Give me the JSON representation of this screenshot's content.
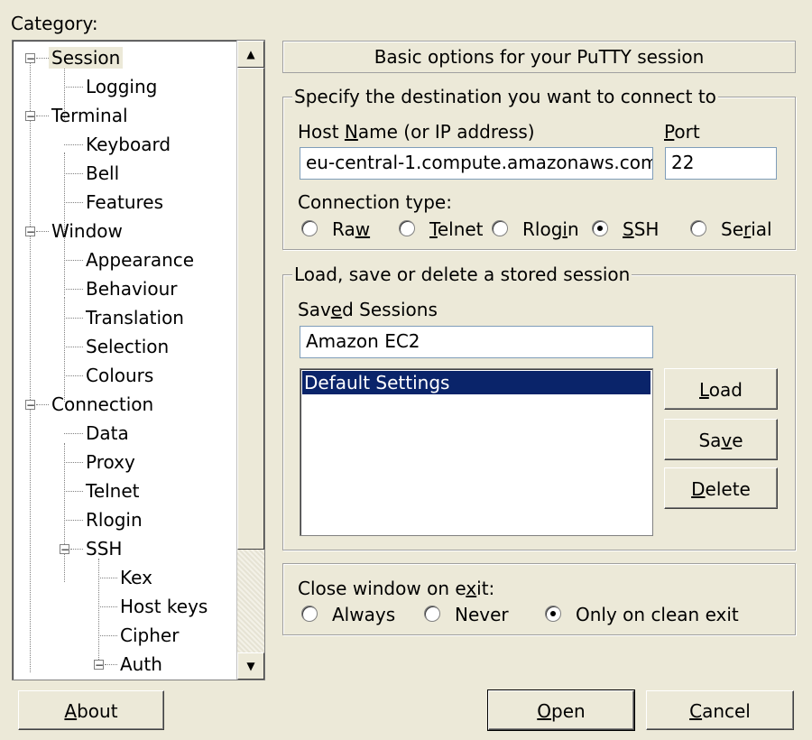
{
  "category_label": "Category:",
  "tree": [
    {
      "label": "Session",
      "expander": "−",
      "selected": true
    },
    {
      "label": "Logging"
    },
    {
      "label": "Terminal",
      "expander": "−"
    },
    {
      "label": "Keyboard"
    },
    {
      "label": "Bell"
    },
    {
      "label": "Features"
    },
    {
      "label": "Window",
      "expander": "−"
    },
    {
      "label": "Appearance"
    },
    {
      "label": "Behaviour"
    },
    {
      "label": "Translation"
    },
    {
      "label": "Selection"
    },
    {
      "label": "Colours"
    },
    {
      "label": "Connection",
      "expander": "−"
    },
    {
      "label": "Data"
    },
    {
      "label": "Proxy"
    },
    {
      "label": "Telnet"
    },
    {
      "label": "Rlogin"
    },
    {
      "label": "SSH",
      "expander": "−"
    },
    {
      "label": "Kex"
    },
    {
      "label": "Host keys"
    },
    {
      "label": "Cipher"
    },
    {
      "label": "Auth",
      "expander": "−"
    }
  ],
  "scrollbar": {
    "up": "▲",
    "down": "▼"
  },
  "header": "Basic options for your PuTTY session",
  "destination": {
    "legend": "Specify the destination you want to connect to",
    "host_label_pre": "Host ",
    "host_label_u": "N",
    "host_label_post": "ame (or IP address)",
    "port_label_u": "P",
    "port_label_post": "ort",
    "host_value": "eu-central-1.compute.amazonaws.com",
    "port_value": "22",
    "conn_type_label": "Connection type:",
    "conn_types": [
      {
        "pre": "Ra",
        "u": "w",
        "post": "",
        "checked": false
      },
      {
        "pre": "",
        "u": "T",
        "post": "elnet",
        "checked": false
      },
      {
        "pre": "Rlog",
        "u": "i",
        "post": "n",
        "checked": false
      },
      {
        "pre": "",
        "u": "S",
        "post": "SH",
        "checked": true
      },
      {
        "pre": "Se",
        "u": "r",
        "post": "ial",
        "checked": false
      }
    ]
  },
  "sessions": {
    "legend": "Load, save or delete a stored session",
    "saved_label_pre": "Sav",
    "saved_label_u": "e",
    "saved_label_post": "d Sessions",
    "input_value": "Amazon EC2",
    "list": [
      "Default Settings"
    ],
    "load_u": "L",
    "load_post": "oad",
    "save_pre": "Sa",
    "save_u": "v",
    "save_post": "e",
    "delete_u": "D",
    "delete_post": "elete"
  },
  "close_on_exit": {
    "label_pre": "Close window on e",
    "label_u": "x",
    "label_post": "it:",
    "options": [
      {
        "label": "Always",
        "checked": false
      },
      {
        "label": "Never",
        "checked": false
      },
      {
        "label": "Only on clean exit",
        "checked": true
      }
    ]
  },
  "buttons": {
    "about_u": "A",
    "about_post": "bout",
    "open_u": "O",
    "open_post": "pen",
    "cancel_u": "C",
    "cancel_post": "ancel"
  }
}
